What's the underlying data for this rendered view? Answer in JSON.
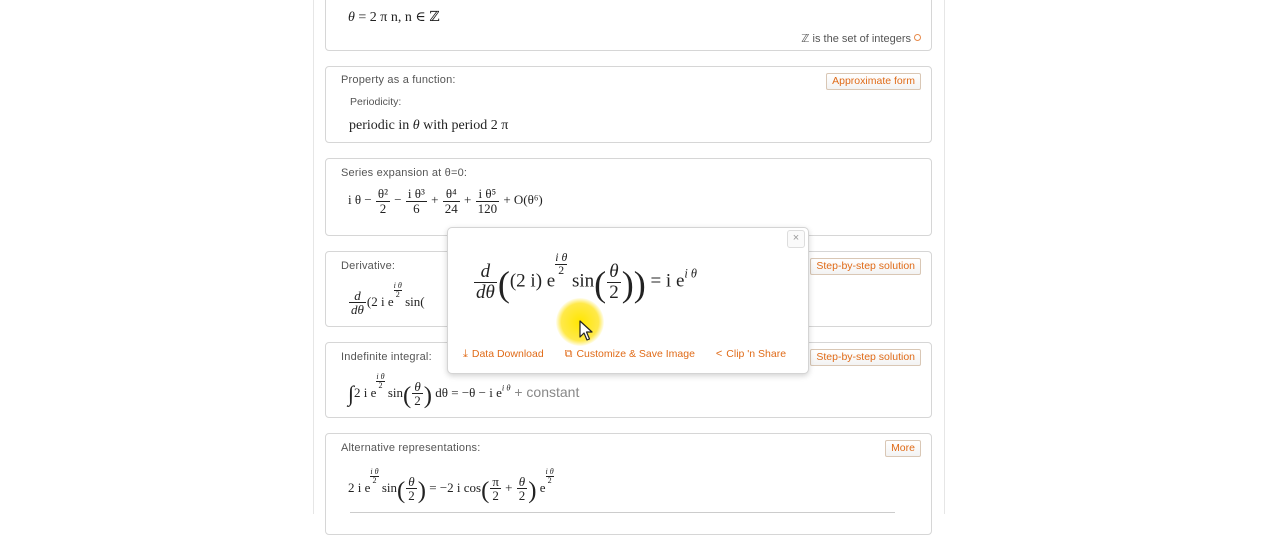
{
  "top_pod": {
    "equation_theta": "θ",
    "equation_rest": " = 2 π n,   n ∈ ",
    "equation_Z": "ℤ",
    "note_Z": "ℤ",
    "note_text": " is the set of integers"
  },
  "property_pod": {
    "title": "Property as a function:",
    "button": "Approximate form",
    "subtitle": "Periodicity:",
    "text_a": "periodic in ",
    "text_theta": "θ",
    "text_b": " with period 2 π"
  },
  "series_pod": {
    "title": "Series expansion at θ=0:",
    "expr": {
      "t1": "i θ − ",
      "f1n": "θ²",
      "f1d": "2",
      "op1": " − ",
      "f2n": "i θ³",
      "f2d": "6",
      "op2": " + ",
      "f3n": "θ⁴",
      "f3d": "24",
      "op3": " + ",
      "f4n": "i θ⁵",
      "f4d": "120",
      "tail": " + O(θ⁶)"
    }
  },
  "derivative_pod": {
    "title": "Derivative:",
    "button": "Step-by-step solution",
    "dn": "d",
    "dd": "dθ",
    "expr": "(2 i e",
    "sup_n": "i θ",
    "sup_d": "2",
    "rest": " sin("
  },
  "integral_pod": {
    "title": "Indefinite integral:",
    "button": "Step-by-step solution",
    "int": "∫",
    "a": "2 i e",
    "sup_n": "i θ",
    "sup_d": "2",
    "sin": " sin",
    "fn": "θ",
    "fd": "2",
    "b": " dθ = −θ − i e",
    "sup2": "i θ",
    "c": " + constant"
  },
  "alt_pod": {
    "title": "Alternative representations:",
    "button": "More",
    "a": "2 i e",
    "sup_n": "i θ",
    "sup_d": "2",
    "sin": " sin",
    "fn": "θ",
    "fd": "2",
    "b": " = −2 i cos",
    "pn": "π",
    "pd": "2",
    "plus": " + ",
    "qn": "θ",
    "qd": "2",
    "c": " e",
    "sup2n": "i θ",
    "sup2d": "2"
  },
  "popup": {
    "close": "×",
    "dn": "d",
    "dd": "dθ",
    "a": "(2 i) e",
    "sup_n": "i θ",
    "sup_d": "2",
    "sin": " sin",
    "fn": "θ",
    "fd": "2",
    "eq": " = i e",
    "sup2": "i θ",
    "actions": {
      "download": "Data Download",
      "customize": "Customize & Save Image",
      "clip": "Clip 'n Share"
    }
  },
  "colors": {
    "accent": "#e06b18",
    "highlight": "#ffe600"
  }
}
